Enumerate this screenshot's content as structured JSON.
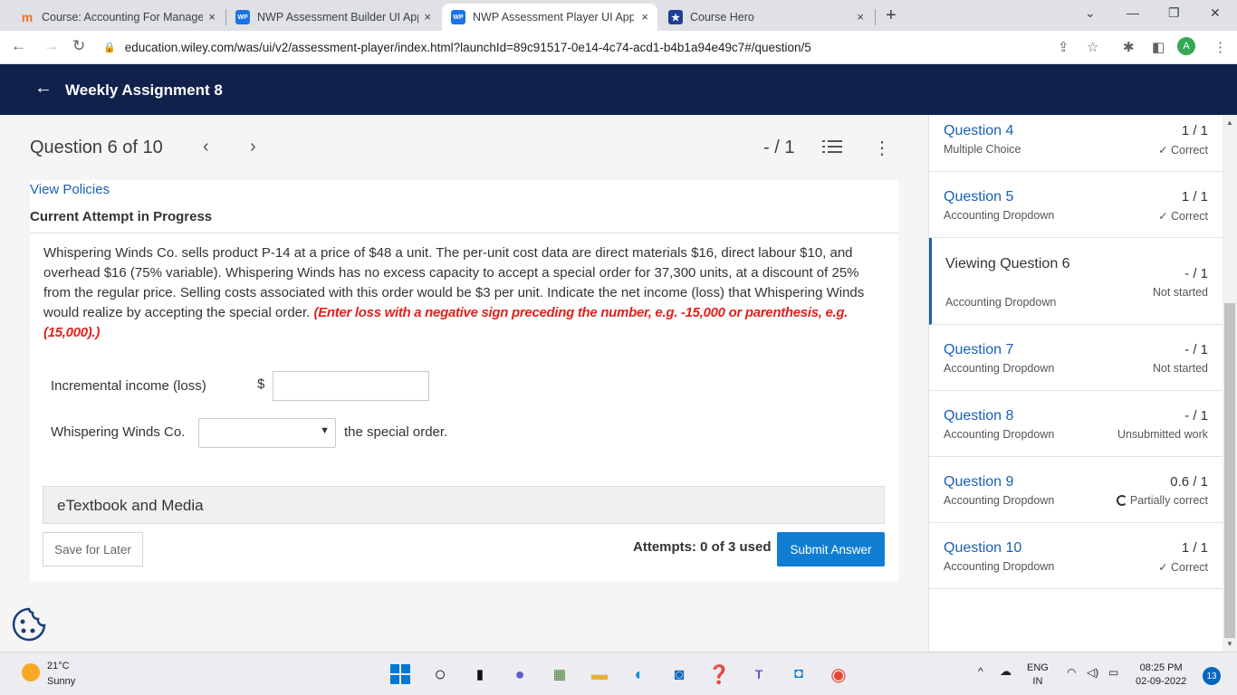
{
  "browser": {
    "tabs": [
      {
        "title": "Course: Accounting For Managem",
        "favicon_color": "#f37021",
        "active": false
      },
      {
        "title": "NWP Assessment Builder UI Appl",
        "favicon_color": "#1a73e8",
        "active": false
      },
      {
        "title": "NWP Assessment Player UI Appli",
        "favicon_color": "#1a73e8",
        "active": true
      },
      {
        "title": "Course Hero",
        "favicon_color": "#1c3f95",
        "active": false
      }
    ],
    "favicon_wp": "WP",
    "favicon_mh": "m",
    "close_glyph": "×",
    "new_tab_glyph": "+",
    "url": "education.wiley.com/was/ui/v2/assessment-player/index.html?launchId=89c91517-0e14-4c74-acd1-b4b1a94e49c7#/question/5",
    "avatar_letter": "A"
  },
  "header": {
    "title": "Weekly Assignment 8",
    "bg_color": "#10214b"
  },
  "question": {
    "position": "Question 6 of 10",
    "score": "- / 1",
    "view_policies": "View Policies",
    "attempt_status": "Current Attempt in Progress",
    "text": "Whispering Winds Co. sells product P-14 at a price of $48 a unit. The per-unit cost data are direct materials $16, direct labour $10, and overhead $16 (75% variable). Whispering Winds has no excess capacity to accept a special order for 37,300 units, at a discount of 25% from the regular price. Selling costs associated with this order would be $3 per unit. Indicate the net income (loss) that Whispering Winds would realize by accepting the special order.",
    "instruction": "(Enter loss with a negative sign preceding the number, e.g. -15,000 or parenthesis, e.g. (15,000).)",
    "instruction_color": "#e2211c",
    "incremental_label": "Incremental income (loss)",
    "currency": "$",
    "incremental_value": "",
    "company_label": "Whispering Winds Co.",
    "select_value": "",
    "after_select": "the special order.",
    "etextbook": "eTextbook and Media",
    "save_label": "Save for Later",
    "attempts": "Attempts: 0 of 3 used",
    "submit_label": "Submit Answer",
    "submit_color": "#0f7ed2"
  },
  "sidebar": {
    "items": [
      {
        "title": "Question 4",
        "type": "Multiple Choice",
        "score": "1 / 1",
        "status": "✓ Correct"
      },
      {
        "title": "Question 5",
        "type": "Accounting Dropdown",
        "score": "1 / 1",
        "status": "✓ Correct"
      },
      {
        "title": "Viewing Question 6",
        "type": "Accounting Dropdown",
        "score": "- / 1",
        "status": "Not started"
      },
      {
        "title": "Question 7",
        "type": "Accounting Dropdown",
        "score": "- / 1",
        "status": "Not started"
      },
      {
        "title": "Question 8",
        "type": "Accounting Dropdown",
        "score": "- / 1",
        "status": "Unsubmitted work"
      },
      {
        "title": "Question 9",
        "type": "Accounting Dropdown",
        "score": "0.6 / 1",
        "status": "Partially correct"
      },
      {
        "title": "Question 10",
        "type": "Accounting Dropdown",
        "score": "1 / 1",
        "status": "✓ Correct"
      }
    ]
  },
  "taskbar": {
    "temp": "21°C",
    "weather": "Sunny",
    "lang": "ENG",
    "region": "IN",
    "time": "08:25 PM",
    "date": "02-09-2022",
    "notifications": "13"
  }
}
